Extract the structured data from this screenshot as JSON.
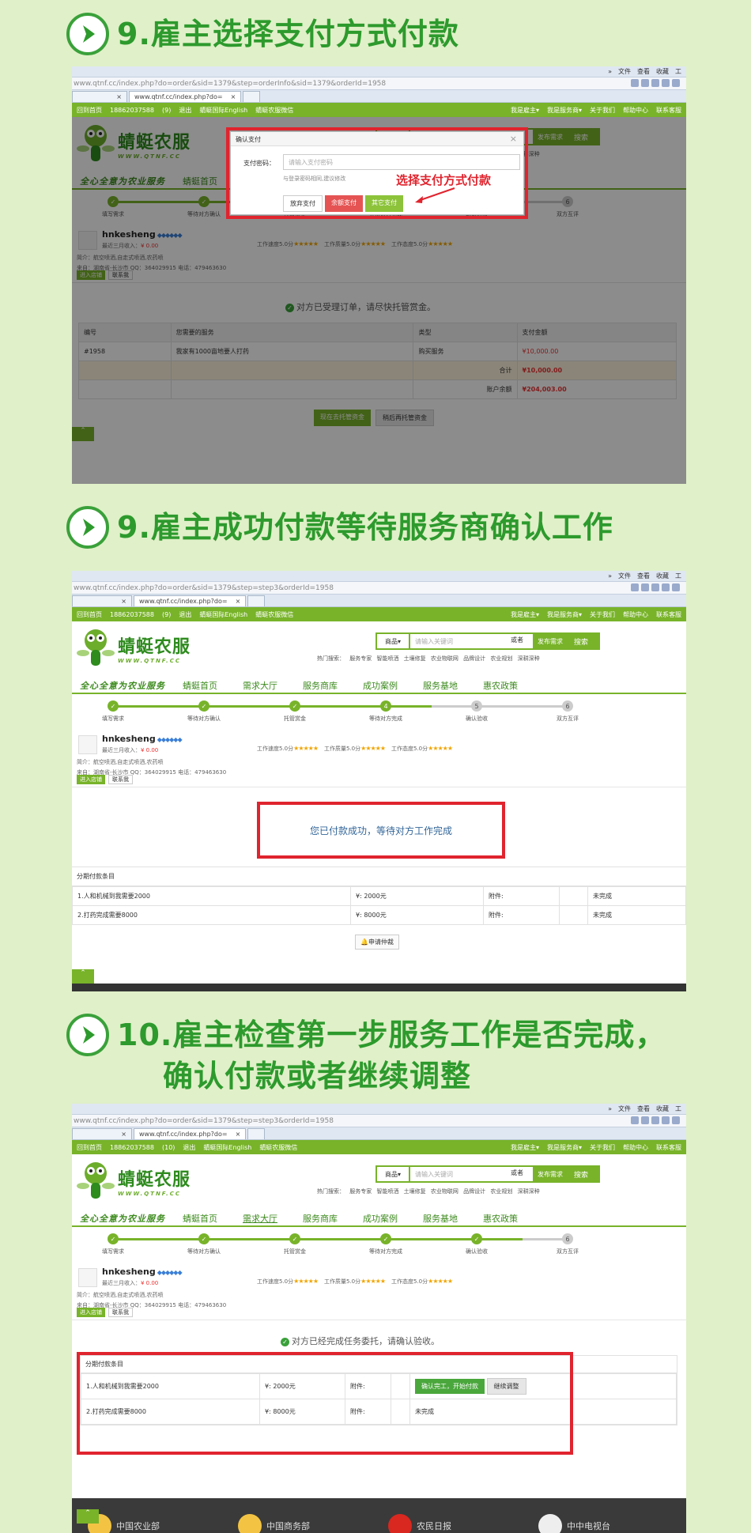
{
  "steps": [
    {
      "title": "9.雇主选择支付方式付款"
    },
    {
      "title": "9.雇主成功付款等待服务商确认工作"
    },
    {
      "title_line1": "10.雇主检查第一步服务工作是否完成，",
      "title_line2": "确认付款或者继续调整"
    }
  ],
  "browser": {
    "menu": [
      "»",
      "文件",
      "查看",
      "收藏",
      "工"
    ],
    "url1": "www.qtnf.cc/index.php?do=order&sid=1379&step=orderInfo&sid=1379&orderId=1958",
    "url2": "www.qtnf.cc/index.php?do=order&sid=1379&step=step3&orderId=1958",
    "url3": "www.qtnf.cc/index.php?do=order&sid=1379&step=step3&orderId=1958",
    "tab_close": "×",
    "tab_active": "www.qtnf.cc/index.php?do=",
    "tab_active_short": "www.qtnf.cc/index.php?do="
  },
  "site": {
    "top_left": [
      "回到首页",
      "18862037588",
      "(9)",
      "退出",
      "蜻蜓国际English",
      "蜻蜓农服微信"
    ],
    "top_left_10": "(10)",
    "top_right": [
      "我是雇主▾",
      "我是服务商▾",
      "关于我们",
      "帮助中心",
      "联系客服"
    ],
    "logo_cn": "蜻蜓农服",
    "logo_en": "WWW.QTNF.CC",
    "search_select": "商品▾",
    "search_placeholder": "请输入关键词",
    "search_btn": "搜索",
    "or": "或者",
    "post_btn": "发布需求",
    "hot": "热门搜索： 服务专家 智能喷洒 土壤修复 农业物联网 品牌设计 农业规划 深耕深种",
    "slogan": "全心全意为农业服务",
    "nav": [
      "蜻蜓首页",
      "需求大厅",
      "服务商库",
      "成功案例",
      "服务基地",
      "惠农政策"
    ]
  },
  "progress": {
    "labels": [
      "填写需求",
      "等待对方确认",
      "托管赏金",
      "等待对方完成",
      "确认验收",
      "双方互评"
    ],
    "numbers": [
      "1",
      "2",
      "3",
      "4",
      "5",
      "6"
    ],
    "shot1_fraction": 0.5,
    "shot2_fraction": 0.7,
    "shot3_fraction": 0.9
  },
  "user": {
    "name": "hnkesheng",
    "diamonds": "◆◆◆◆◆◆",
    "income_label": "最近三月收入：",
    "income": "¥ 0.00",
    "rate1": "工作速度5.0分",
    "rate2": "工作质量5.0分",
    "rate3": "工作态度5.0分",
    "stars": "★★★★★",
    "intro": "简介：航空喷洒,自走式喷洒,农药喷",
    "from": "来自：湖南省-长沙市   QQ：364029915   电话：479463630",
    "btn_shop": "进入店铺",
    "btn_contact": "联系我"
  },
  "modal": {
    "title": "确认支付",
    "close": "×",
    "label": "支付密码：",
    "placeholder": "请输入支付密码",
    "hint": "与登录密码相同,建议修改",
    "btn_cancel": "放弃支付",
    "btn_balance": "余额支付",
    "btn_other": "其它支付",
    "annotation": "选择支付方式付款"
  },
  "order": {
    "accepted_msg": "对方已受理订单，请尽快托管赏金。",
    "headers": [
      "编号",
      "您需要的服务",
      "类型",
      "支付金额"
    ],
    "row": [
      "#1958",
      "我家有1000亩地要人打药",
      "购买服务",
      "¥10,000.00"
    ],
    "total_label": "合计",
    "total": "¥10,000.00",
    "balance_label": "账户余额",
    "balance": "¥204,003.00",
    "btn_pay": "现在去托管资金",
    "btn_later": "稍后再托管资金"
  },
  "shot2": {
    "success_msg": "您已付款成功，等待对方工作完成",
    "section": "分期付款条目",
    "rows": [
      {
        "name": "1.人和机械到我需要2000",
        "amount": "¥: 2000元",
        "attach": "附件:",
        "status": "未完成"
      },
      {
        "name": "2.打药完成需要8000",
        "amount": "¥: 8000元",
        "attach": "附件:",
        "status": "未完成"
      }
    ],
    "arbitrate": "申请仲裁"
  },
  "shot3": {
    "msg": "对方已经完成任务委托，请确认验收。",
    "section": "分期付款条目",
    "rows": [
      {
        "name": "1.人和机械到我需要2000",
        "amount": "¥: 2000元",
        "attach": "附件:"
      },
      {
        "name": "2.打药完成需要8000",
        "amount": "¥: 8000元",
        "attach": "附件:",
        "status": "未完成"
      }
    ],
    "btn_confirm": "确认完工，开始付款",
    "btn_adjust": "继续调整",
    "partners": [
      "中国农业部",
      "中国商务部",
      "农民日报",
      "中中电视台"
    ]
  }
}
